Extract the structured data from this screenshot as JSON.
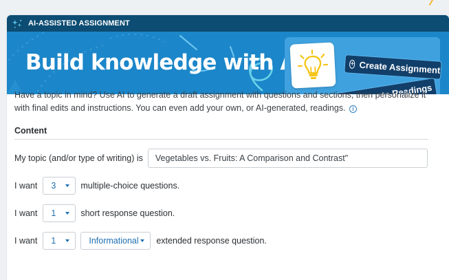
{
  "header": {
    "label": "AI-ASSISTED ASSIGNMENT",
    "icon": "sparkle-icon"
  },
  "banner": {
    "title": "Build knowledge with AI",
    "bulb_icon": "lightbulb-icon",
    "create_label": "Create Assignment",
    "generate_label": "Generate Readings"
  },
  "intro": {
    "text": "Have a topic in mind? Use AI to generate a draft assignment with questions and sections, then personalize it with final edits and instructions. You can even add your own, or AI-generated, readings.",
    "info_icon": "info-icon"
  },
  "content": {
    "section_title": "Content",
    "topic": {
      "label": "My topic (and/or type of writing) is",
      "value": "Vegetables vs. Fruits: A Comparison and Contrast\""
    },
    "multiple_choice": {
      "prefix": "I want",
      "count": "3",
      "suffix": "multiple-choice questions."
    },
    "short_response": {
      "prefix": "I want",
      "count": "1",
      "suffix": "short response question."
    },
    "extended_response": {
      "prefix": "I want",
      "count": "1",
      "type": "Informational",
      "suffix": "extended response question."
    }
  },
  "colors": {
    "header_bg": "#0d4d73",
    "banner_bg": "#1b86c9",
    "pill_bg": "#123f6a",
    "accent_link": "#1f6fb0",
    "bulb_yellow": "#f5c518"
  }
}
